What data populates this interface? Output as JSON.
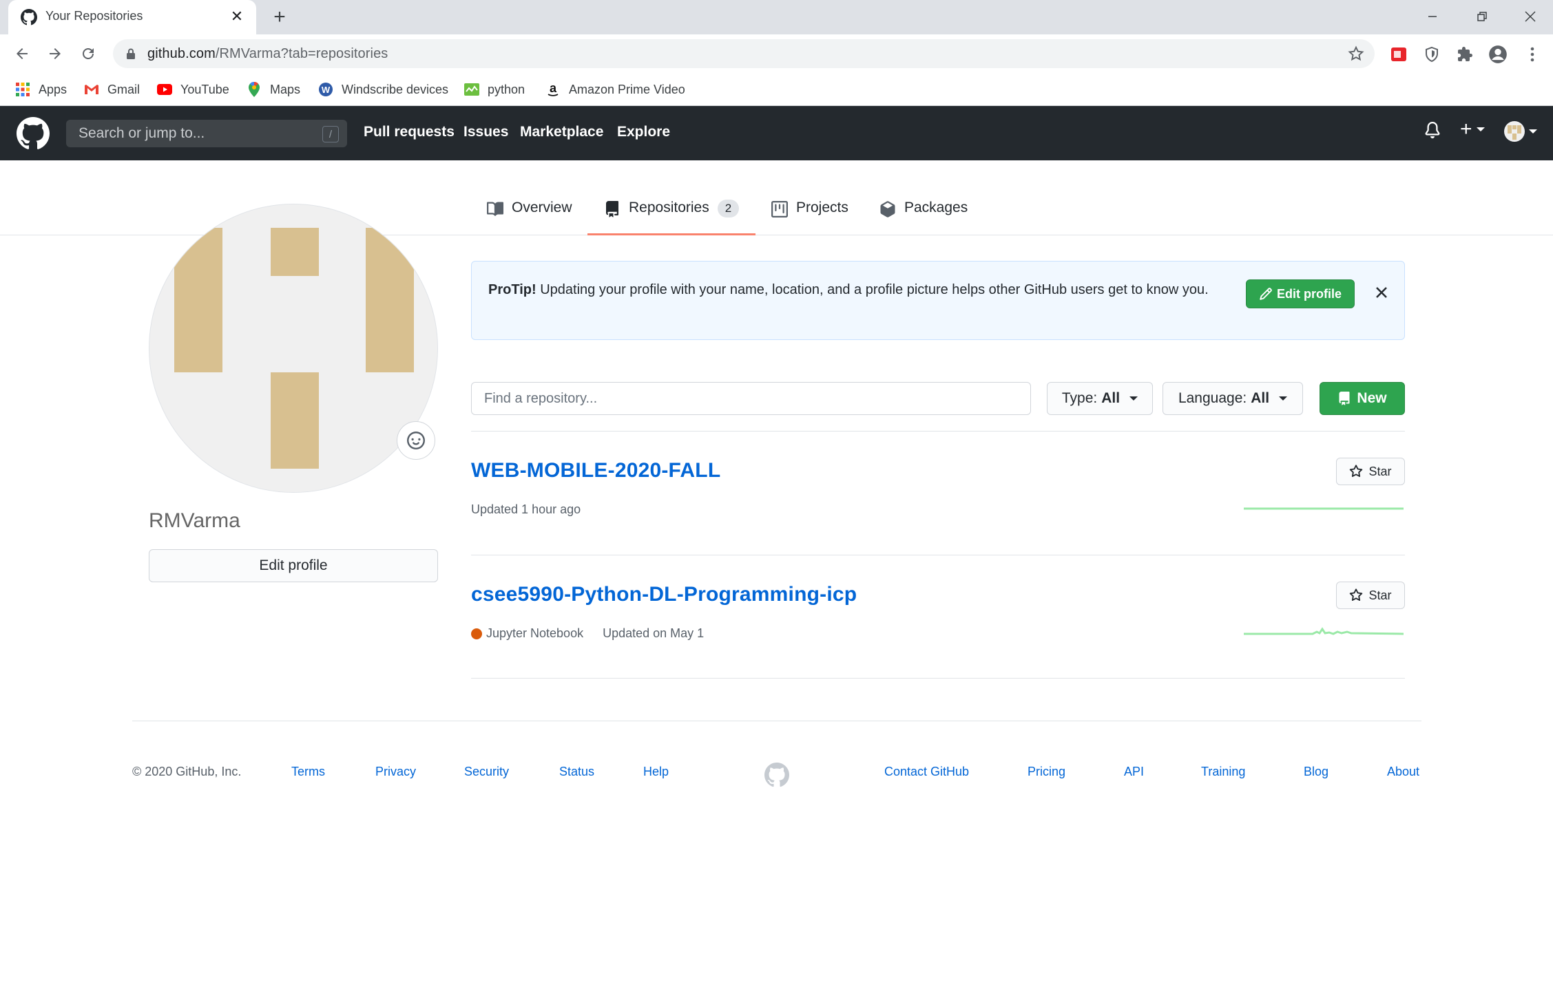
{
  "browser": {
    "tab_title": "Your Repositories",
    "url_host": "github.com",
    "url_path": "/RMVarma?tab=repositories",
    "bookmarks": [
      {
        "label": "Apps",
        "icon": "apps-grid-icon"
      },
      {
        "label": "Gmail",
        "icon": "gmail-icon"
      },
      {
        "label": "YouTube",
        "icon": "youtube-icon"
      },
      {
        "label": "Maps",
        "icon": "maps-icon"
      },
      {
        "label": "Windscribe devices",
        "icon": "windscribe-icon"
      },
      {
        "label": "python",
        "icon": "python-bookmark-icon"
      },
      {
        "label": "Amazon Prime Video",
        "icon": "amazon-icon"
      }
    ]
  },
  "header": {
    "search_placeholder": "Search or jump to...",
    "slash_key": "/",
    "nav": [
      "Pull requests",
      "Issues",
      "Marketplace",
      "Explore"
    ]
  },
  "profile_tabs": [
    {
      "label": "Overview"
    },
    {
      "label": "Repositories",
      "count": "2",
      "active": true
    },
    {
      "label": "Projects"
    },
    {
      "label": "Packages"
    }
  ],
  "sidebar": {
    "username": "RMVarma",
    "edit_profile": "Edit profile"
  },
  "protip": {
    "title": "ProTip!",
    "text": "Updating your profile with your name, location, and a profile picture helps other GitHub users get to know you.",
    "button": "Edit profile"
  },
  "filters": {
    "find_placeholder": "Find a repository...",
    "type_label": "Type:",
    "type_value": "All",
    "language_label": "Language:",
    "language_value": "All",
    "new_label": "New"
  },
  "repos": [
    {
      "name": "WEB-MOBILE-2020-FALL",
      "language": "",
      "updated": "Updated 1 hour ago",
      "star_label": "Star"
    },
    {
      "name": "csee5990-Python-DL-Programming-icp",
      "language": "Jupyter Notebook",
      "language_color": "#da5b0b",
      "updated": "Updated on May 1",
      "star_label": "Star"
    }
  ],
  "footer": {
    "copyright": "© 2020 GitHub, Inc.",
    "left_links": [
      "Terms",
      "Privacy",
      "Security",
      "Status",
      "Help"
    ],
    "right_links": [
      "Contact GitHub",
      "Pricing",
      "API",
      "Training",
      "Blog",
      "About"
    ]
  },
  "colors": {
    "header_bg": "#24292e",
    "link": "#0366d6",
    "green": "#2ea44f",
    "active_tab": "#f9826c",
    "protip_bg": "#f1f8ff"
  }
}
